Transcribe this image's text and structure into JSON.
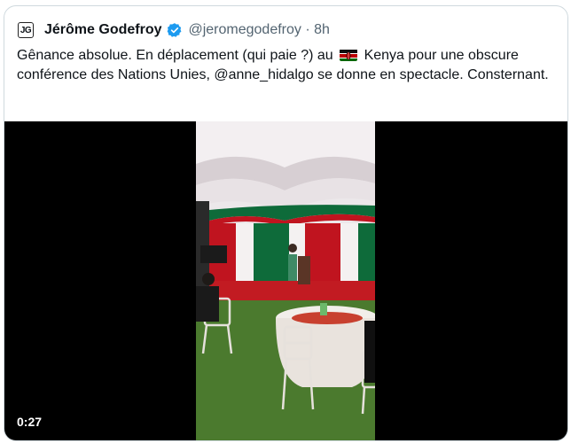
{
  "tweet": {
    "avatar_initials": "JG",
    "author_name": "Jérôme Godefroy",
    "verified_icon": "verified-badge-icon",
    "handle_and_time": "@jeromegodefroy · 8h",
    "text_part1": "Gênance absolue. En déplacement (qui paie ?) au",
    "flag_icon": "kenya-flag-icon",
    "text_part2": "Kenya pour une obscure conférence des Nations Unies, @anne_hidalgo se donne en spectacle. Consternant."
  },
  "video": {
    "duration": "0:27"
  },
  "colors": {
    "accent_blue": "#1d9bf0",
    "border": "#cfd9de",
    "secondary_text": "#536471"
  }
}
